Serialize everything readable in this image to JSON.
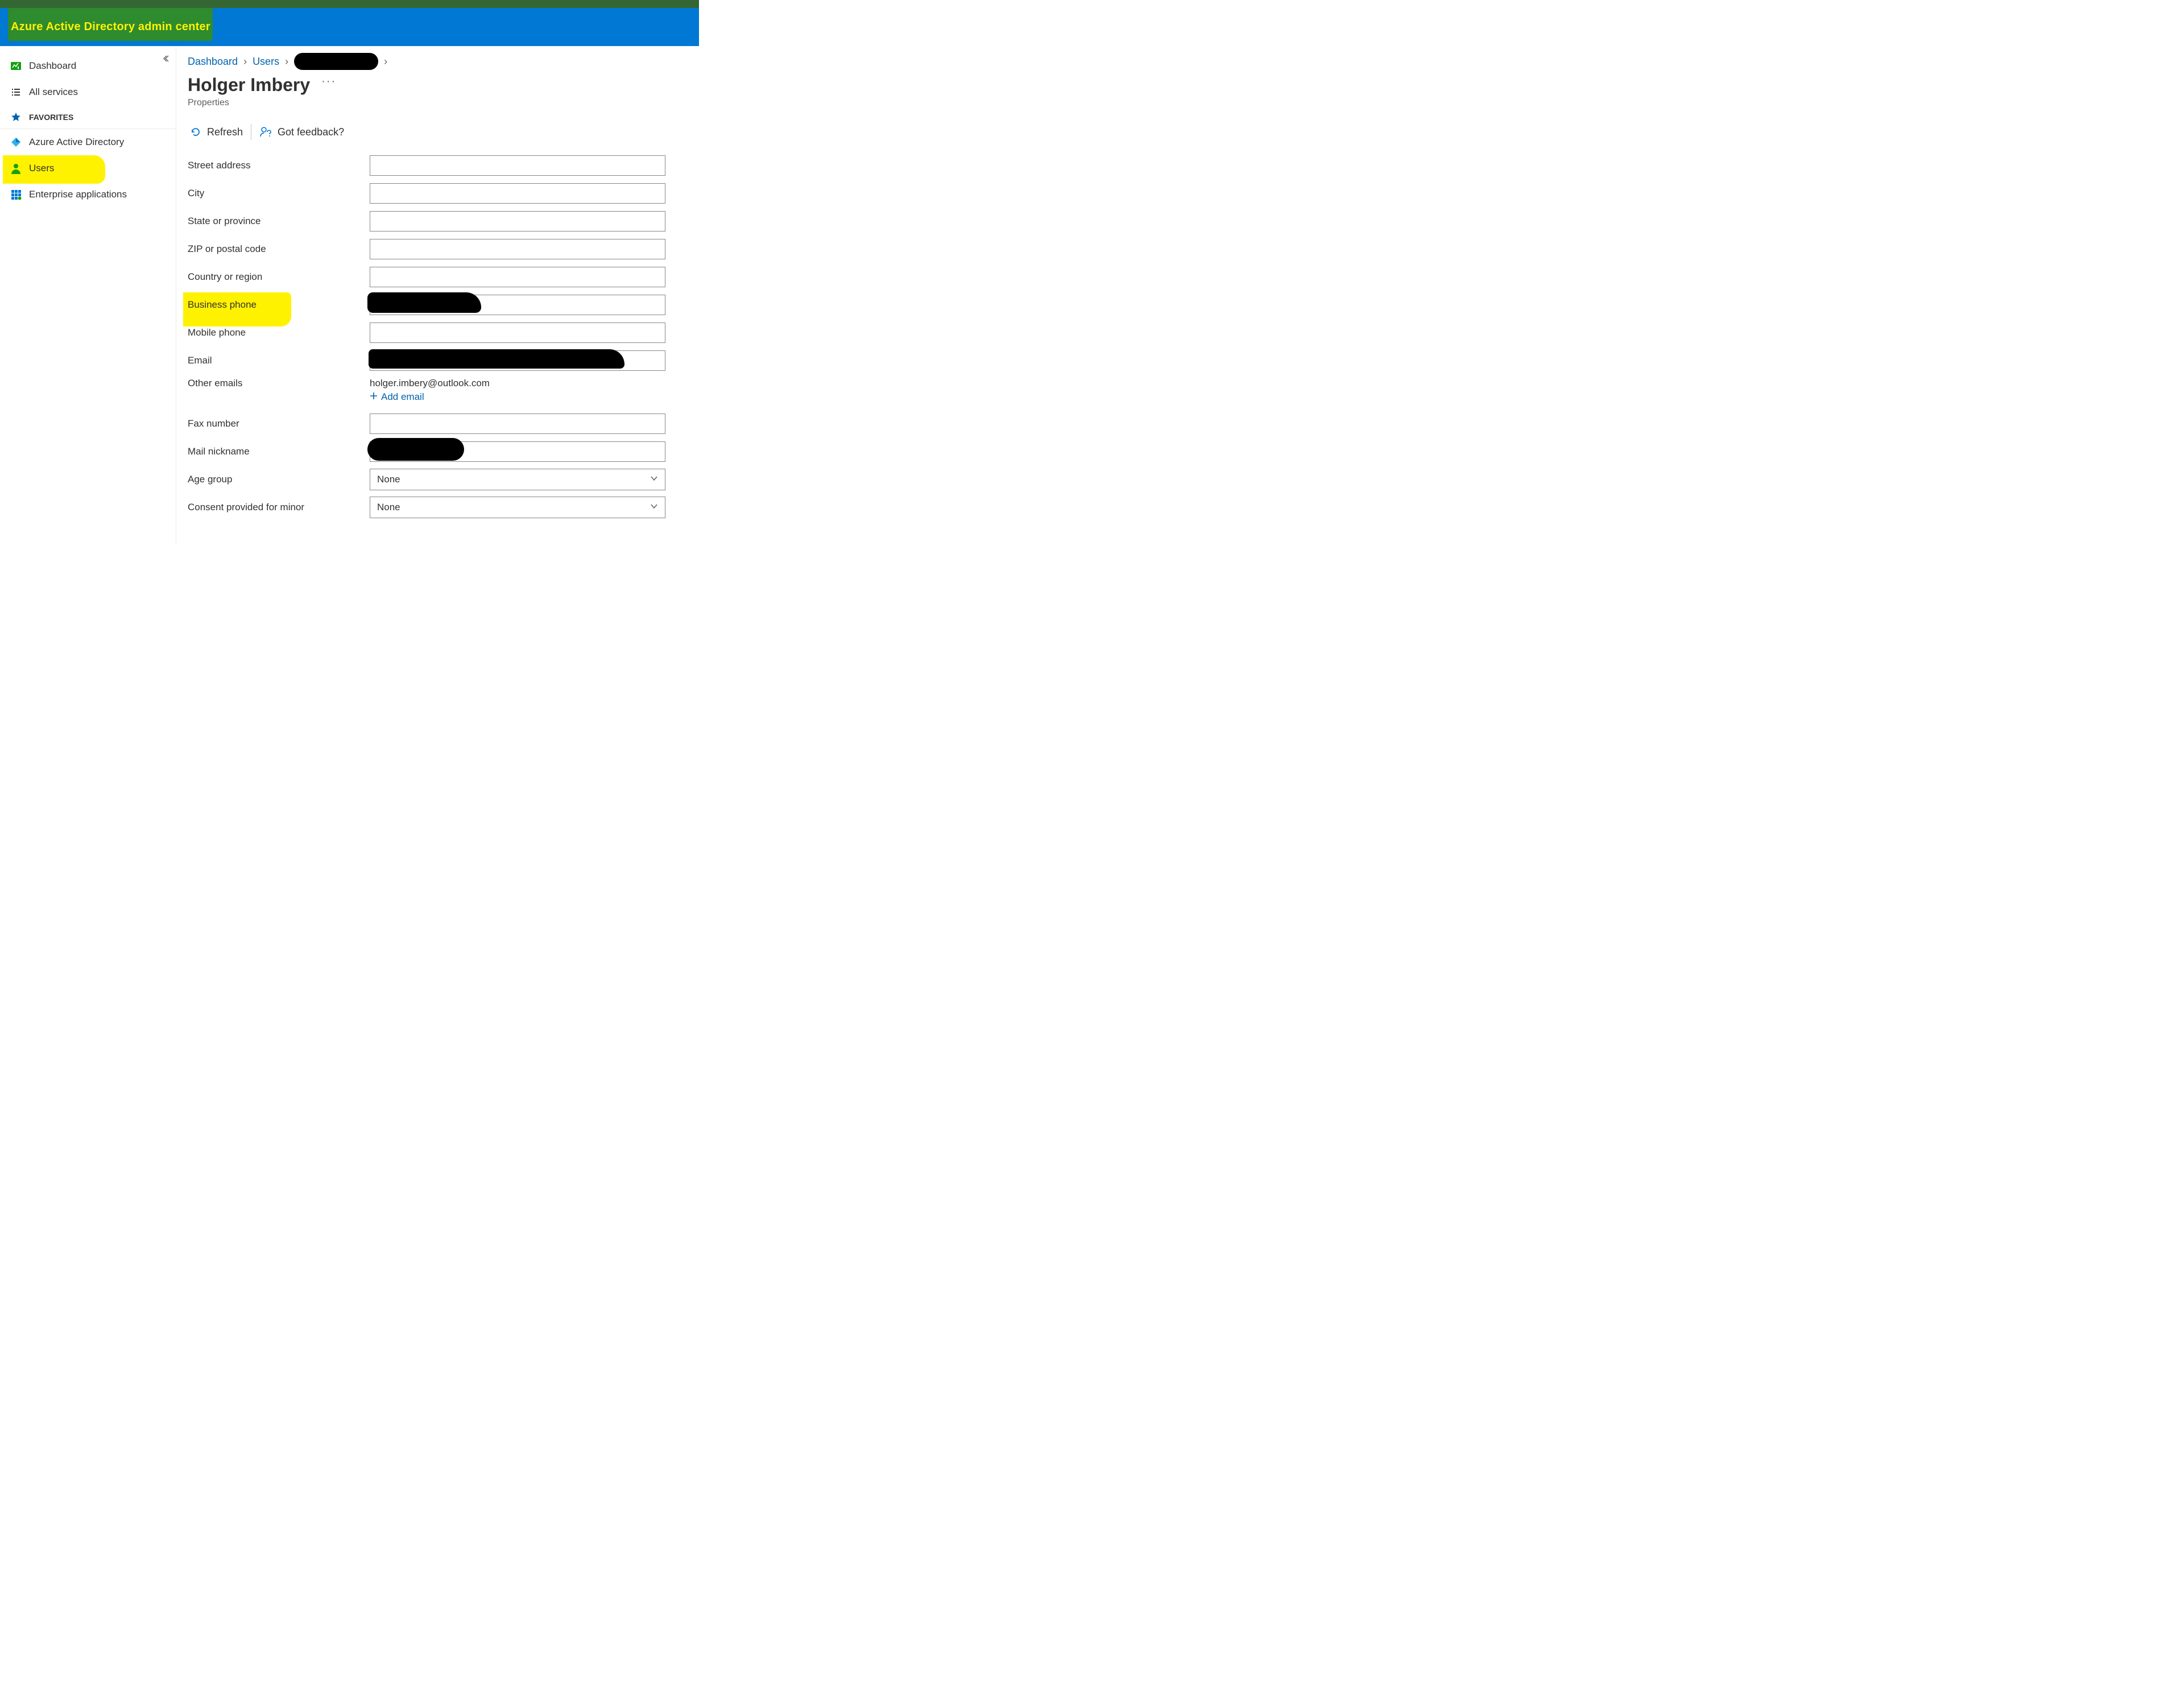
{
  "app": {
    "title": "Azure Active Directory admin center"
  },
  "sidebar": {
    "dashboard": "Dashboard",
    "all_services": "All services",
    "favorites_header": "FAVORITES",
    "aad": "Azure Active Directory",
    "users": "Users",
    "enterprise_apps": "Enterprise applications"
  },
  "breadcrumb": {
    "dashboard": "Dashboard",
    "users": "Users"
  },
  "page": {
    "title": "Holger Imbery",
    "subtitle": "Properties"
  },
  "commands": {
    "refresh": "Refresh",
    "feedback": "Got feedback?"
  },
  "fields": {
    "street": "Street address",
    "city": "City",
    "state": "State or province",
    "zip": "ZIP or postal code",
    "country": "Country or region",
    "business_phone": "Business phone",
    "mobile_phone": "Mobile phone",
    "email": "Email",
    "other_emails": "Other emails",
    "other_emails_value": "holger.imbery@outlook.com",
    "add_email": "Add email",
    "fax": "Fax number",
    "mail_nickname": "Mail nickname",
    "age_group": "Age group",
    "age_group_value": "None",
    "consent": "Consent provided for minor",
    "consent_value": "None"
  }
}
